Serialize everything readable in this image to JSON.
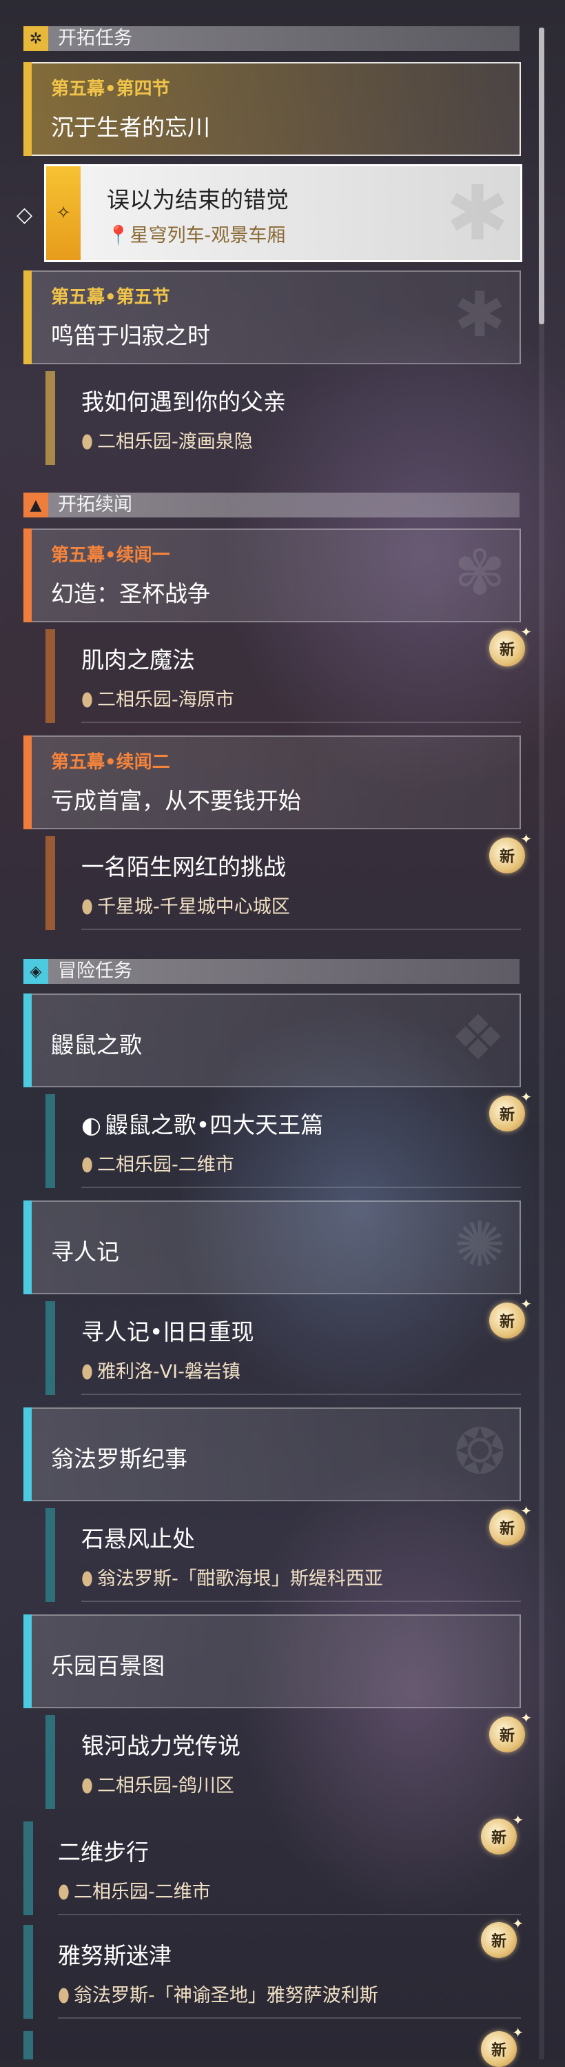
{
  "sections": {
    "trailblaze": "开拓任务",
    "companion": "开拓续闻",
    "adventure": "冒险任务"
  },
  "trailblaze": {
    "c1": {
      "chapter": "第五幕•第四节",
      "title": "沉于生者的忘川"
    },
    "s1": {
      "title": "误以为结束的错觉",
      "location": "星穹列车-观景车厢"
    },
    "c2": {
      "chapter": "第五幕•第五节",
      "title": "鸣笛于归寂之时"
    },
    "s2": {
      "title": "我如何遇到你的父亲",
      "location": "二相乐园-渡画泉隐"
    }
  },
  "companion": {
    "c1": {
      "chapter": "第五幕•续闻一",
      "title": "幻造：圣杯战争"
    },
    "s1": {
      "title": "肌肉之魔法",
      "location": "二相乐园-海原市"
    },
    "c2": {
      "chapter": "第五幕•续闻二",
      "title": "亏成首富，从不要钱开始"
    },
    "s2": {
      "title": "一名陌生网红的挑战",
      "location": "千星城-千星城中心城区"
    }
  },
  "adventure": {
    "c1": {
      "title": "鼹鼠之歌"
    },
    "s1": {
      "title": "鼹鼠之歌•四大天王篇",
      "location": "二相乐园-二维市"
    },
    "c2": {
      "title": "寻人记"
    },
    "s2": {
      "title": "寻人记•旧日重现",
      "location": "雅利洛-VI-磐岩镇"
    },
    "c3": {
      "title": "翁法罗斯纪事"
    },
    "s3": {
      "title": "石悬风止处",
      "location": "翁法罗斯-「酣歌海垠」斯缇科西亚"
    },
    "c4": {
      "title": "乐园百景图"
    },
    "s4": {
      "title": "银河战力党传说",
      "location": "二相乐园-鸽川区"
    },
    "s5": {
      "title": "二维步行",
      "location": "二相乐园-二维市"
    },
    "s6": {
      "title": "雅努斯迷津",
      "location": "翁法罗斯-「神谕圣地」雅努萨波利斯"
    }
  },
  "badges": {
    "new": "新"
  },
  "colors": {
    "trailblaze": "#e8b83a",
    "companion": "#ef7d3c",
    "adventure": "#4ccbe0",
    "chapter_gold": "#f0c44a",
    "chapter_orange": "#f4843c"
  },
  "icons": {
    "trailblaze_section": "star-burst-icon",
    "companion_section": "triangle-emblem-icon",
    "adventure_section": "compass-diamond-icon",
    "location": "map-pin-icon",
    "tracking": "diamond-pointer-icon",
    "new_badge": "new-sparkle-icon"
  }
}
